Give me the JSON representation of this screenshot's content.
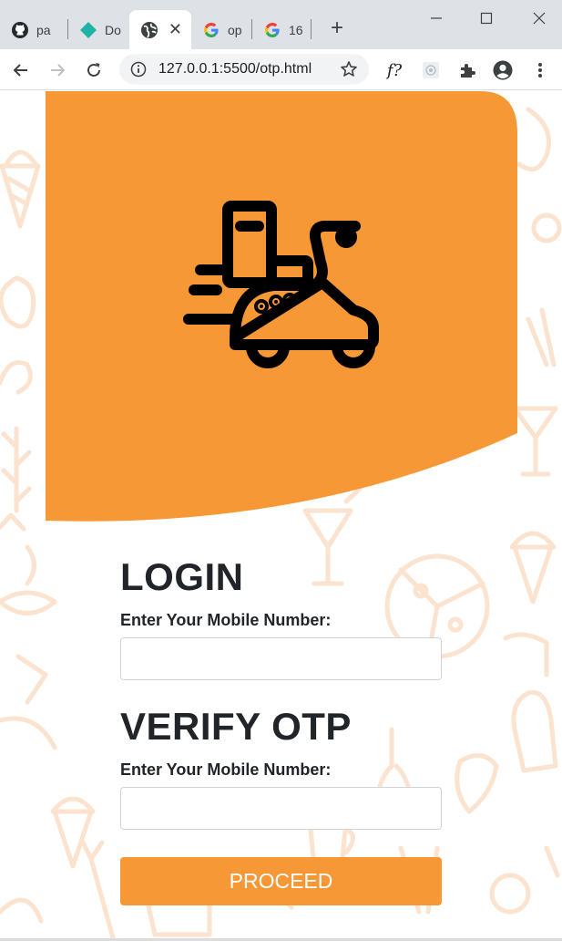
{
  "browser": {
    "tabs": [
      {
        "label": "pa",
        "icon": "github-icon"
      },
      {
        "label": "Do",
        "icon": "diamond-icon"
      },
      {
        "label": "",
        "icon": "globe-icon",
        "active": true
      },
      {
        "label": "op",
        "icon": "google-icon"
      },
      {
        "label": "16",
        "icon": "google-icon"
      }
    ],
    "new_tab": "+",
    "url": "127.0.0.1:5500/otp.html",
    "extension_text": "f?"
  },
  "page": {
    "login_title": "LOGIN",
    "login_label": "Enter Your Mobile Number:",
    "login_value": "",
    "verify_title": "VERIFY OTP",
    "verify_label": "Enter Your Mobile Number:",
    "verify_value": "",
    "proceed_label": "PROCEED"
  },
  "colors": {
    "accent": "#f79837",
    "doodle": "#fbe3cf",
    "text": "#212529",
    "tabstrip": "#dee1e6"
  }
}
